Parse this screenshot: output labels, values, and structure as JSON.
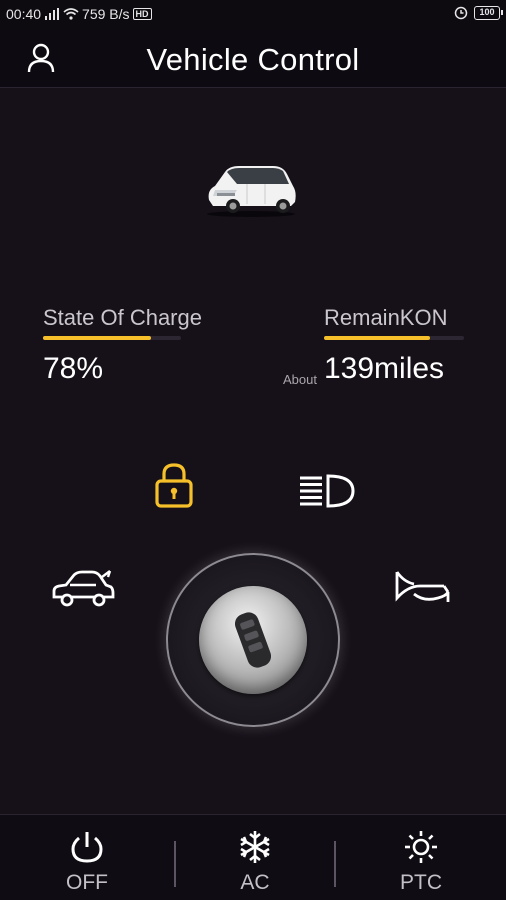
{
  "status_bar": {
    "time": "00:40",
    "network_speed": "759 B/s",
    "hd_badge": "HD",
    "battery": "100",
    "icons": [
      "signal-icon",
      "wifi-icon",
      "alarm-icon"
    ]
  },
  "header": {
    "title": "Vehicle Control",
    "user_icon": "user-icon"
  },
  "stats": {
    "charge": {
      "label": "State Of Charge",
      "value": "78%",
      "level": 0.78
    },
    "range": {
      "label": "RemainKON",
      "prefix": "About",
      "value": "139miles",
      "level": 0.76
    }
  },
  "controls": {
    "lock": "lock-icon",
    "headlight": "headlight-icon",
    "car": "car-trunk-icon",
    "horn": "horn-icon",
    "key": "key-fob-icon"
  },
  "tabs": [
    {
      "label": "OFF",
      "icon": "power-icon"
    },
    {
      "label": "AC",
      "icon": "snowflake-icon"
    },
    {
      "label": "PTC",
      "icon": "sun-icon"
    }
  ],
  "colors": {
    "background": "#161019",
    "accent": "#f5c02a",
    "icon": "#ffffff"
  }
}
